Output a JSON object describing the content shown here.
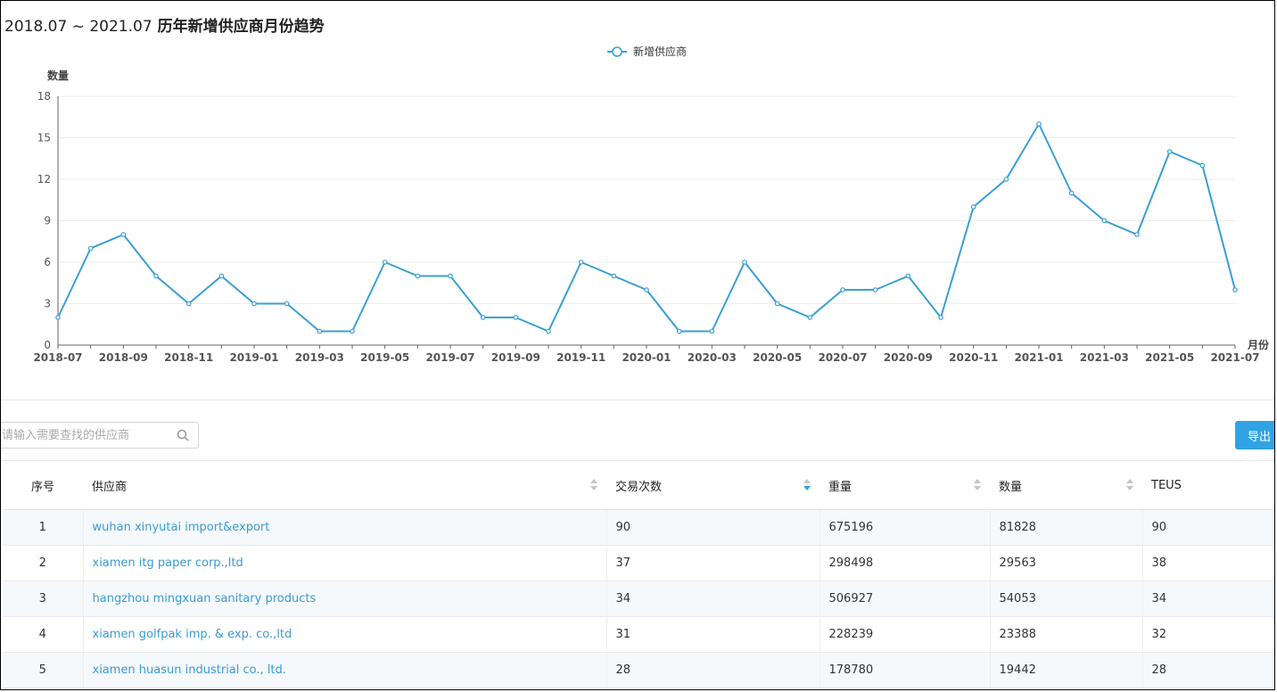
{
  "title": {
    "range": "2018.07 ~ 2021.07",
    "text": "历年新增供应商月份趋势"
  },
  "chart_data": {
    "type": "line",
    "ylabel": "数量",
    "xlabel": "月份",
    "ylim": [
      0,
      18
    ],
    "yticks": [
      0,
      3,
      6,
      9,
      12,
      15,
      18
    ],
    "x": [
      "2018-07",
      "2018-08",
      "2018-09",
      "2018-10",
      "2018-11",
      "2018-12",
      "2019-01",
      "2019-02",
      "2019-03",
      "2019-04",
      "2019-05",
      "2019-06",
      "2019-07",
      "2019-08",
      "2019-09",
      "2019-10",
      "2019-11",
      "2019-12",
      "2020-01",
      "2020-02",
      "2020-03",
      "2020-04",
      "2020-05",
      "2020-06",
      "2020-07",
      "2020-08",
      "2020-09",
      "2020-10",
      "2020-11",
      "2020-12",
      "2021-01",
      "2021-02",
      "2021-03",
      "2021-04",
      "2021-05",
      "2021-06",
      "2021-07"
    ],
    "xticks": [
      "2018-07",
      "2018-09",
      "2018-11",
      "2019-01",
      "2019-03",
      "2019-05",
      "2019-07",
      "2019-09",
      "2019-11",
      "2020-01",
      "2020-03",
      "2020-05",
      "2020-07",
      "2020-09",
      "2020-11",
      "2021-01",
      "2021-03",
      "2021-05",
      "2021-07"
    ],
    "series": [
      {
        "name": "新增供应商",
        "values": [
          2,
          7,
          8,
          5,
          3,
          5,
          3,
          3,
          1,
          1,
          6,
          5,
          5,
          2,
          2,
          1,
          6,
          5,
          4,
          1,
          1,
          6,
          3,
          2,
          4,
          4,
          5,
          2,
          10,
          12,
          16,
          11,
          9,
          8,
          14,
          13,
          4
        ]
      }
    ],
    "grid": true,
    "legend": "top-center",
    "color": "#3a9fd3"
  },
  "search": {
    "placeholder": "请输入需要查找的供应商"
  },
  "export_label": "导出",
  "table": {
    "columns": [
      "序号",
      "供应商",
      "交易次数",
      "重量",
      "数量",
      "TEUS"
    ],
    "rows": [
      [
        "1",
        "wuhan xinyutai import&export",
        "90",
        "675196",
        "81828",
        "90"
      ],
      [
        "2",
        "xiamen itg paper corp.,ltd",
        "37",
        "298498",
        "29563",
        "38"
      ],
      [
        "3",
        "hangzhou mingxuan sanitary products",
        "34",
        "506927",
        "54053",
        "34"
      ],
      [
        "4",
        "xiamen golfpak imp. & exp. co.,ltd",
        "31",
        "228239",
        "23388",
        "32"
      ],
      [
        "5",
        "xiamen huasun industrial co., ltd.",
        "28",
        "178780",
        "19442",
        "28"
      ]
    ]
  },
  "colors": {
    "accent": "#31a3e5",
    "link": "#3a9bd5"
  }
}
